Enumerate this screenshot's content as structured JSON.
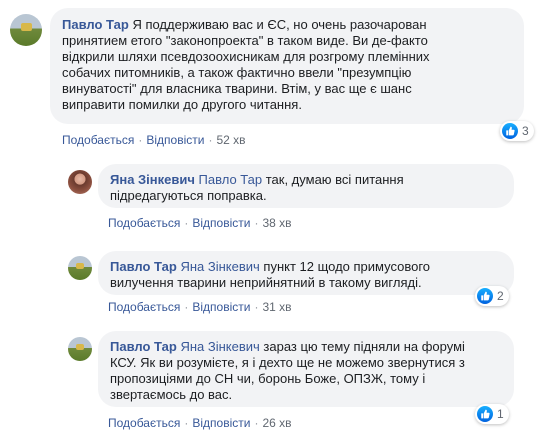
{
  "comments": [
    {
      "author": "Павло Тар",
      "lines": [
        "Я поддерживаю вас и ЄС, но очень разочарован",
        "принятием етого \"законопроекта\" в таком виде. Ви де-факто",
        "відкрили шляхи псевдозоохисникам для розгрому племінних",
        "собачих питомників, а також фактично ввели \"презумпцію",
        "винуватості\" для власника тварини. Втім, у вас ще є шанс",
        "виправити помилки до другого читання."
      ],
      "like_label": "Подобається",
      "reply_label": "Відповісти",
      "time": "52 хв",
      "reaction_count": "3"
    },
    {
      "author": "Яна Зінкевич",
      "mention": "Павло Тар",
      "lines": [
        " так, думаю всі питання",
        "підредагуються поправка."
      ],
      "like_label": "Подобається",
      "reply_label": "Відповісти",
      "time": "38 хв"
    },
    {
      "author": "Павло Тар",
      "mention": "Яна Зінкевич",
      "lines": [
        " пункт 12 щодо примусового",
        "вилучення тварини неприйнятний в такому вигляді."
      ],
      "like_label": "Подобається",
      "reply_label": "Відповісти",
      "time": "31 хв",
      "reaction_count": "2"
    },
    {
      "author": "Павло Тар",
      "mention": "Яна Зінкевич",
      "lines": [
        " зараз цю тему підняли на форумі",
        "КСУ. Як ви розумієте, я і дехто ще не можемо звернутися з",
        "пропозиціями до СН чи, боронь Боже, ОПЗЖ, тому і",
        "звертаємось до вас."
      ],
      "like_label": "Подобається",
      "reply_label": "Відповісти",
      "time": "26 хв",
      "reaction_count": "1"
    }
  ],
  "colors": {
    "author": "#385898",
    "bubble": "#f2f3f5",
    "meta": "#606770",
    "like": "#1877f2"
  },
  "icons": {
    "reaction": "thumbs-up-icon"
  }
}
